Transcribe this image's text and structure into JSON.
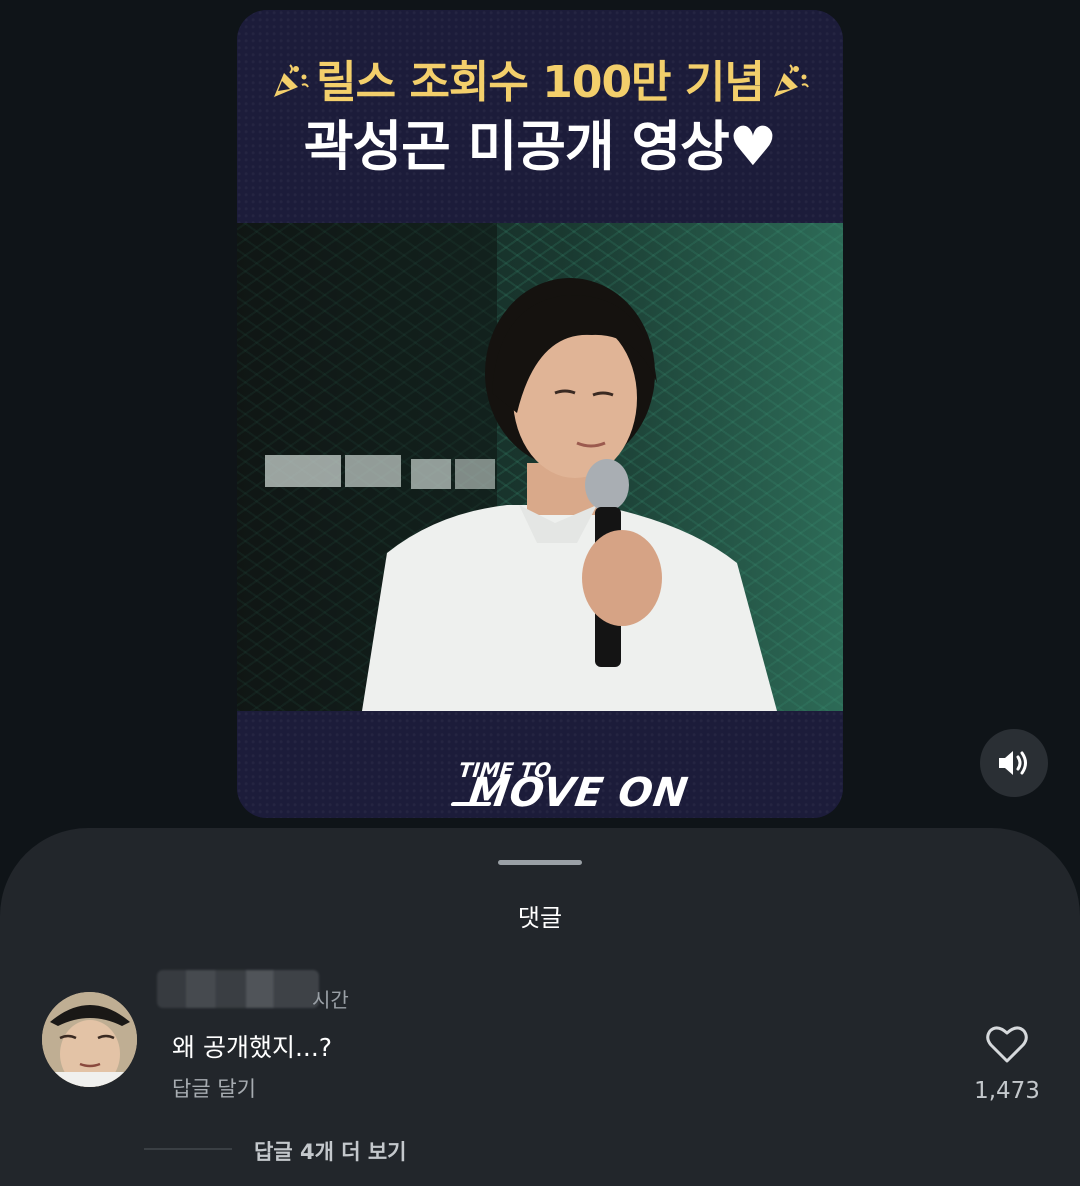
{
  "video": {
    "headline_line1": "릴스 조회수 100만 기념",
    "headline_line2": "곽성곤 미공개 영상♥",
    "slogan_small": "TIME TO",
    "slogan_big": "MOVE ON"
  },
  "controls": {
    "sound_icon": "volume-icon"
  },
  "comments_sheet": {
    "title": "댓글",
    "comments": [
      {
        "timestamp": "시간",
        "text": "왜 공개했지...?",
        "reply_label": "답글 달기",
        "like_count": "1,473",
        "more_replies_label": "답글 4개 더 보기"
      }
    ]
  },
  "colors": {
    "background": "#0f1418",
    "sheet": "#22262b",
    "headline_gold": "#f3cf6b"
  }
}
